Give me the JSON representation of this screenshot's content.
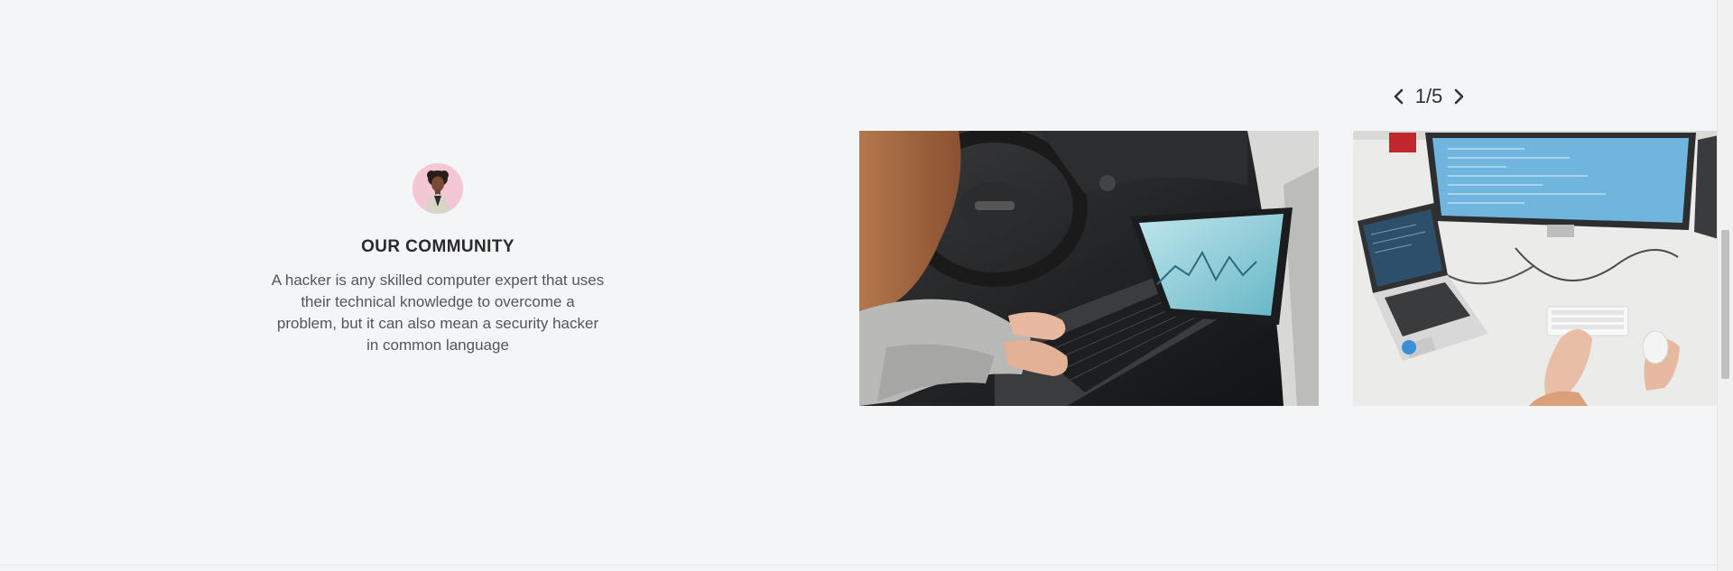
{
  "community": {
    "avatar_icon": "person-avatar",
    "title": "OUR COMMUNITY",
    "description": "A hacker is any skilled computer expert that uses their technical knowledge to overcome a problem, but it can also mean a security hacker in common language"
  },
  "carousel": {
    "pager_text": "1/5",
    "prev_icon": "chevron-left-icon",
    "next_icon": "chevron-right-icon",
    "current_slide": 1,
    "total_slides": 5
  },
  "colors": {
    "background": "#f4f5f7",
    "avatar_bg": "#f3c7d3"
  }
}
